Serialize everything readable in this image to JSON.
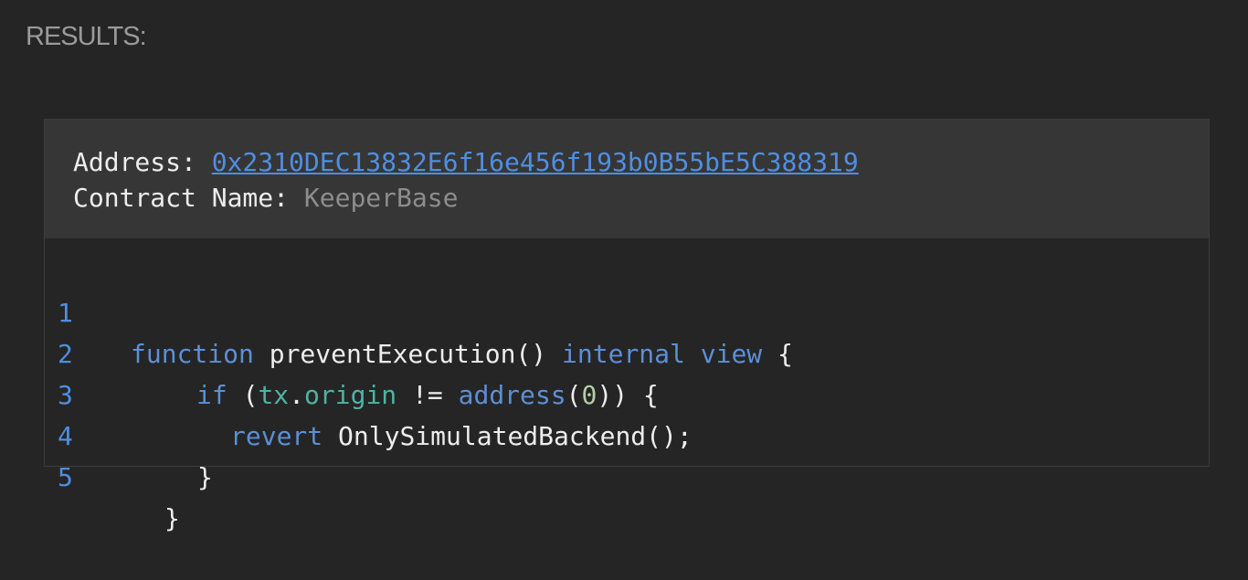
{
  "page": {
    "heading": "RESULTS:"
  },
  "result": {
    "address_label": "Address: ",
    "address_value": "0x2310DEC13832E6f16e456f193b0B55bE5C388319",
    "contract_label": "Contract Name: ",
    "contract_value": "KeeperBase"
  },
  "code": {
    "line_numbers": [
      "1",
      "2",
      "3",
      "4",
      "5"
    ],
    "line1": {
      "kw_function": "function",
      "name": " preventExecution() ",
      "kw_internal": "internal",
      "kw_view": "view",
      "tail": " {"
    },
    "line2": {
      "kw_if": "if",
      "paren_open": " (",
      "tx": "tx",
      "dot": ".",
      "origin": "origin",
      "neq": " != ",
      "kw_address": "address",
      "lparen": "(",
      "zero": "0",
      "tail": ")) {"
    },
    "line3": {
      "kw_revert": "revert",
      "call": " OnlySimulatedBackend();"
    },
    "line4": "}",
    "line5": "}"
  },
  "colors": {
    "background": "#252525",
    "header_background": "#363636",
    "link": "#4f8ee3",
    "keyword": "#5c8fd6",
    "property": "#4fb3a3",
    "number": "#b5cea8",
    "muted": "#8d8d8d",
    "text": "#ededed"
  }
}
